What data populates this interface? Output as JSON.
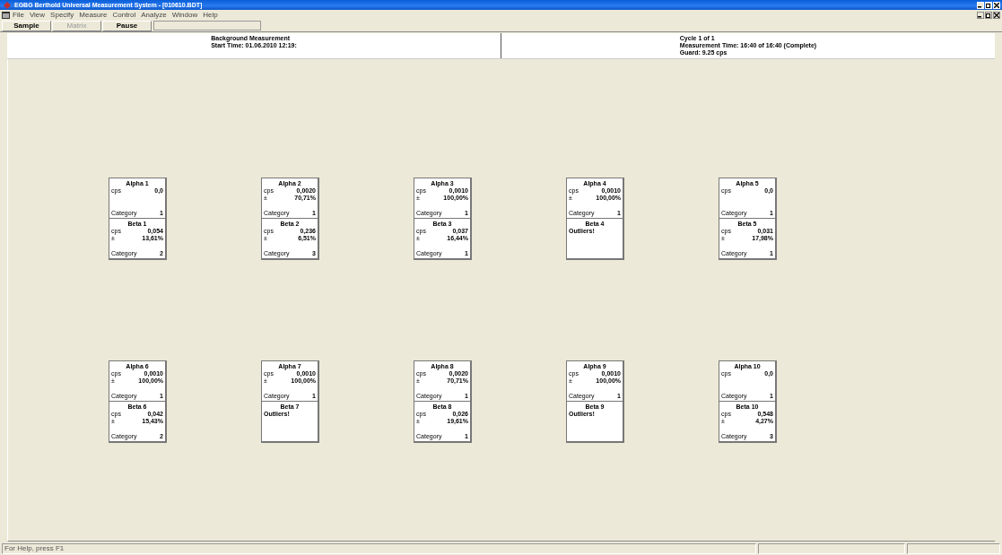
{
  "window": {
    "title": "EGBG Berthold Universal Measurement System - [010610.BDT]"
  },
  "menu": [
    "File",
    "View",
    "Specify",
    "Measure",
    "Control",
    "Analyze",
    "Window",
    "Help"
  ],
  "toolbar": {
    "buttons": [
      {
        "label": "Sample",
        "disabled": false
      },
      {
        "label": "Matrix",
        "disabled": true
      },
      {
        "label": "Pause",
        "disabled": false
      }
    ]
  },
  "header": {
    "left": [
      "Background Measurement",
      "Start Time: 01.06.2010  12:19:"
    ],
    "right": [
      "Cycle 1 of 1",
      "Measurement Time:   16:40  of   16:40 (Complete)",
      "Guard: 9.25 cps"
    ]
  },
  "detectors": [
    {
      "alpha": {
        "title": "Alpha 1",
        "rows": [
          {
            "label": "cps",
            "value": "0,0"
          }
        ],
        "category": {
          "label": "Category",
          "value": "1"
        }
      },
      "beta": {
        "title": "Beta 1",
        "rows": [
          {
            "label": "cps",
            "value": "0,054"
          },
          {
            "label": "±",
            "value": "13,61%"
          }
        ],
        "category": {
          "label": "Category",
          "value": "2"
        }
      }
    },
    {
      "alpha": {
        "title": "Alpha 2",
        "rows": [
          {
            "label": "cps",
            "value": "0,0020"
          },
          {
            "label": "±",
            "value": "70,71%"
          }
        ],
        "category": {
          "label": "Category",
          "value": "1"
        }
      },
      "beta": {
        "title": "Beta 2",
        "rows": [
          {
            "label": "cps",
            "value": "0,236"
          },
          {
            "label": "±",
            "value": "6,51%"
          }
        ],
        "category": {
          "label": "Category",
          "value": "3"
        }
      }
    },
    {
      "alpha": {
        "title": "Alpha 3",
        "rows": [
          {
            "label": "cps",
            "value": "0,0010"
          },
          {
            "label": "±",
            "value": "100,00%"
          }
        ],
        "category": {
          "label": "Category",
          "value": "1"
        }
      },
      "beta": {
        "title": "Beta 3",
        "rows": [
          {
            "label": "cps",
            "value": "0,037"
          },
          {
            "label": "±",
            "value": "16,44%"
          }
        ],
        "category": {
          "label": "Category",
          "value": "1"
        }
      }
    },
    {
      "alpha": {
        "title": "Alpha 4",
        "rows": [
          {
            "label": "cps",
            "value": "0,0010"
          },
          {
            "label": "±",
            "value": "100,00%"
          }
        ],
        "category": {
          "label": "Category",
          "value": "1"
        }
      },
      "beta": {
        "title": "Beta 4",
        "note": "Outliers!"
      }
    },
    {
      "alpha": {
        "title": "Alpha 5",
        "rows": [
          {
            "label": "cps",
            "value": "0,0"
          }
        ],
        "category": {
          "label": "Category",
          "value": "1"
        }
      },
      "beta": {
        "title": "Beta 5",
        "rows": [
          {
            "label": "cps",
            "value": "0,031"
          },
          {
            "label": "±",
            "value": "17,98%"
          }
        ],
        "category": {
          "label": "Category",
          "value": "1"
        }
      }
    },
    {
      "alpha": {
        "title": "Alpha 6",
        "rows": [
          {
            "label": "cps",
            "value": "0,0010"
          },
          {
            "label": "±",
            "value": "100,00%"
          }
        ],
        "category": {
          "label": "Category",
          "value": "1"
        }
      },
      "beta": {
        "title": "Beta 6",
        "rows": [
          {
            "label": "cps",
            "value": "0,042"
          },
          {
            "label": "±",
            "value": "15,43%"
          }
        ],
        "category": {
          "label": "Category",
          "value": "2"
        }
      }
    },
    {
      "alpha": {
        "title": "Alpha 7",
        "rows": [
          {
            "label": "cps",
            "value": "0,0010"
          },
          {
            "label": "±",
            "value": "100,00%"
          }
        ],
        "category": {
          "label": "Category",
          "value": "1"
        }
      },
      "beta": {
        "title": "Beta 7",
        "note": "Outliers!"
      }
    },
    {
      "alpha": {
        "title": "Alpha 8",
        "rows": [
          {
            "label": "cps",
            "value": "0,0020"
          },
          {
            "label": "±",
            "value": "70,71%"
          }
        ],
        "category": {
          "label": "Category",
          "value": "1"
        }
      },
      "beta": {
        "title": "Beta 8",
        "rows": [
          {
            "label": "cps",
            "value": "0,026"
          },
          {
            "label": "±",
            "value": "19,61%"
          }
        ],
        "category": {
          "label": "Category",
          "value": "1"
        }
      }
    },
    {
      "alpha": {
        "title": "Alpha 9",
        "rows": [
          {
            "label": "cps",
            "value": "0,0010"
          },
          {
            "label": "±",
            "value": "100,00%"
          }
        ],
        "category": {
          "label": "Category",
          "value": "1"
        }
      },
      "beta": {
        "title": "Beta 9",
        "note": "Outliers!"
      }
    },
    {
      "alpha": {
        "title": "Alpha 10",
        "rows": [
          {
            "label": "cps",
            "value": "0,0"
          }
        ],
        "category": {
          "label": "Category",
          "value": "1"
        }
      },
      "beta": {
        "title": "Beta 10",
        "rows": [
          {
            "label": "cps",
            "value": "0,548"
          },
          {
            "label": "±",
            "value": "4,27%"
          }
        ],
        "category": {
          "label": "Category",
          "value": "3"
        }
      }
    }
  ],
  "status_bar": {
    "text": "For Help, press F1"
  }
}
